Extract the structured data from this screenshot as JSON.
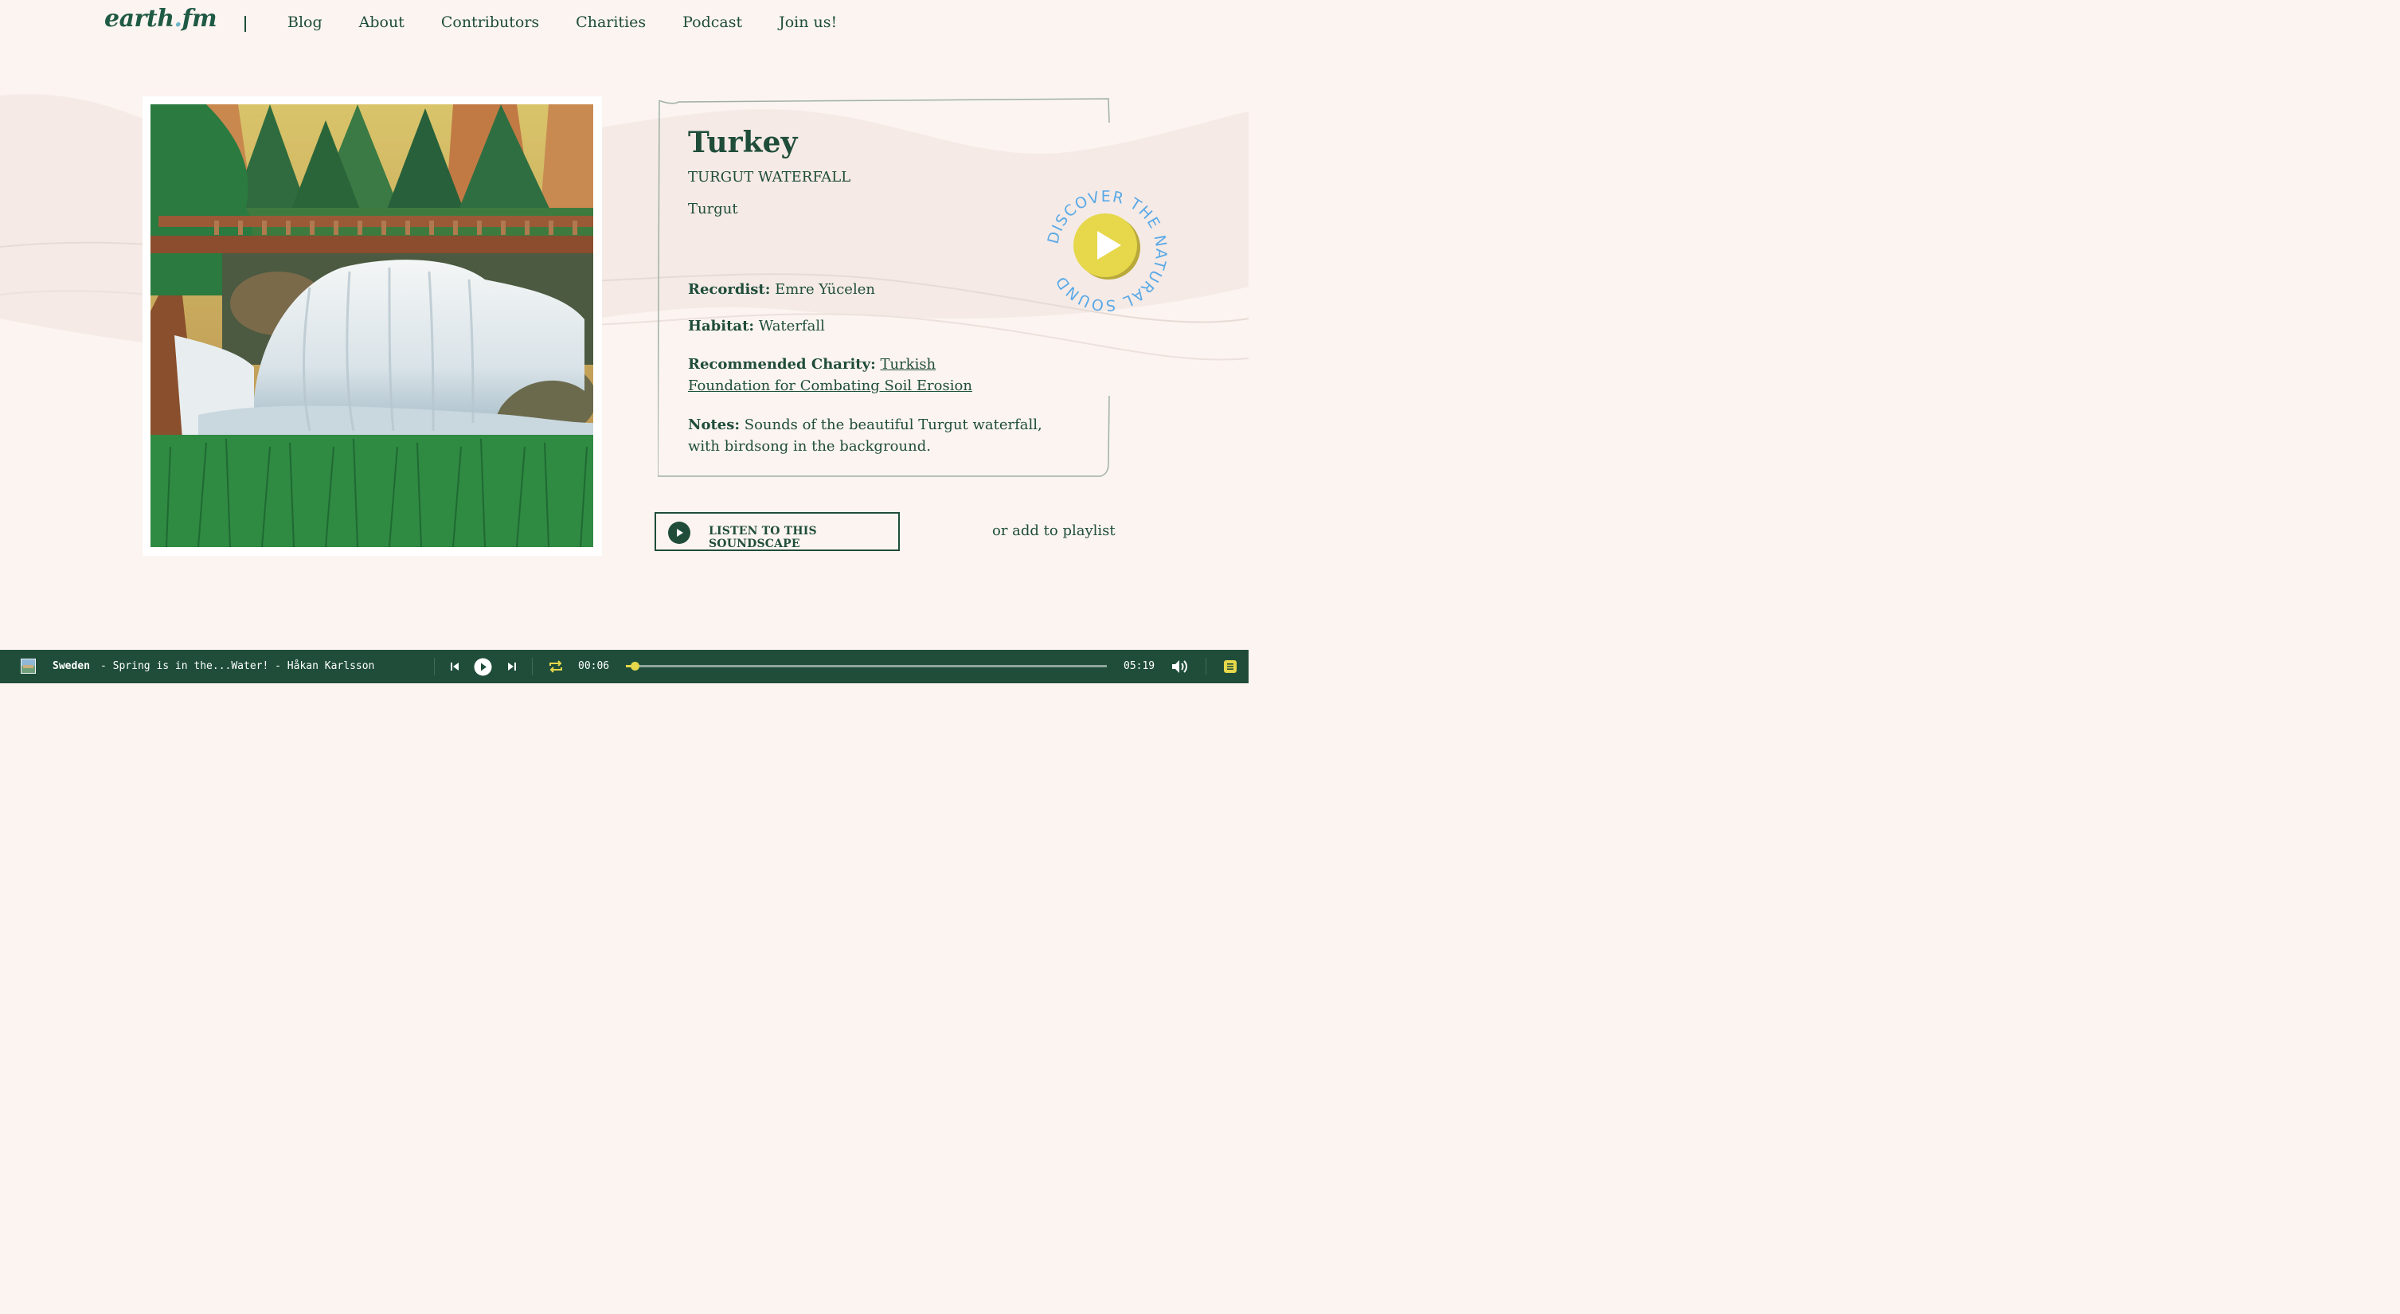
{
  "site": {
    "logo_main": "earth",
    "logo_dot": ".",
    "logo_tld": "fm"
  },
  "nav": {
    "items": [
      {
        "label": "Blog"
      },
      {
        "label": "About"
      },
      {
        "label": "Contributors"
      },
      {
        "label": "Charities"
      },
      {
        "label": "Podcast"
      },
      {
        "label": "Join us!"
      }
    ]
  },
  "soundscape": {
    "country": "Turkey",
    "location": "TURGUT WATERFALL",
    "sublocation": "Turgut",
    "recordist_label": "Recordist:",
    "recordist": "Emre Yücelen",
    "habitat_label": "Habitat:",
    "habitat": "Waterfall",
    "charity_label": "Recommended Charity:",
    "charity": "Turkish Foundation for Combating Soil Erosion",
    "notes_label": "Notes:",
    "notes": "Sounds of the beautiful Turgut waterfall, with birdsong in the background."
  },
  "discover_badge": {
    "text": "DISCOVER THE NATURAL SOUND",
    "icon": "play-icon",
    "color": "#e6d84a",
    "text_color": "#5aa9e6"
  },
  "actions": {
    "listen_label": "LISTEN TO THIS SOUNDSCAPE",
    "playlist_label": "or add to playlist"
  },
  "player": {
    "country": "Sweden",
    "title": "- Spring is in the...Water! - Håkan Karlsson",
    "current_time": "00:06",
    "total_time": "05:19",
    "progress": 0.019,
    "accent": "#e6d84a",
    "background": "#1f4d3a"
  }
}
